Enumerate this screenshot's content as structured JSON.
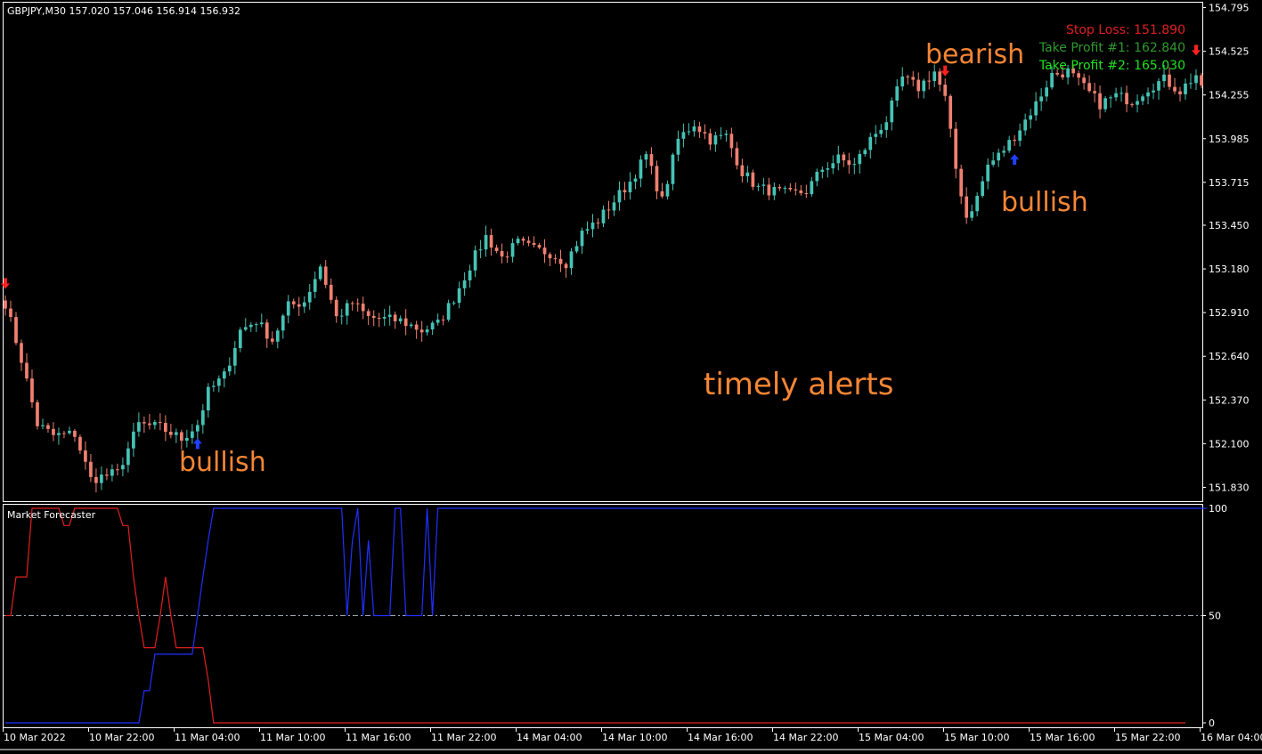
{
  "window": {
    "symbol_line": "GBPJPY,M30  157.020 157.046 156.914 156.932",
    "indicator_name": "Market Forecaster"
  },
  "colors": {
    "background": "#000000",
    "frame": "#ffffff",
    "bull_candle": "#45c3b5",
    "bear_candle": "#f08070",
    "annotation": "#f58634",
    "stop_loss": "#e02020",
    "take_profit_1": "#2e9a2e",
    "take_profit_2": "#22e022",
    "buy_arrow": "#2040ff",
    "sell_arrow": "#ff2020",
    "line_red": "#e02020",
    "line_blue": "#2030ff",
    "midline": "#9aa4b4"
  },
  "levels": {
    "stop_loss": "Stop Loss: 151.890",
    "take_profit_1": "Take Profit #1: 162.840",
    "take_profit_2": "Take Profit #2: 165.030"
  },
  "annotations": {
    "bullish_left": "bullish",
    "bullish_right": "bullish",
    "bearish": "bearish",
    "timely_alerts": "timely alerts"
  },
  "chart_data": [
    {
      "type": "candlestick",
      "title": "GBPJPY,M30",
      "ylim": [
        151.75,
        154.82
      ],
      "y_ticks": [
        "154.795",
        "154.525",
        "154.255",
        "153.985",
        "153.715",
        "153.450",
        "153.180",
        "152.910",
        "152.640",
        "152.370",
        "152.100",
        "151.830"
      ],
      "x_ticks": [
        "10 Mar 2022",
        "10 Mar 22:00",
        "11 Mar 04:00",
        "11 Mar 10:00",
        "11 Mar 16:00",
        "11 Mar 22:00",
        "14 Mar 04:00",
        "14 Mar 10:00",
        "14 Mar 16:00",
        "14 Mar 22:00",
        "15 Mar 04:00",
        "15 Mar 10:00",
        "15 Mar 16:00",
        "15 Mar 22:00",
        "16 Mar 04:00"
      ],
      "signals": [
        {
          "type": "sell",
          "index": 0
        },
        {
          "type": "buy",
          "index": 36
        },
        {
          "type": "sell",
          "index": 176
        },
        {
          "type": "buy",
          "index": 189
        },
        {
          "type": "sell",
          "index": 223
        }
      ],
      "close_path": [
        [
          0,
          152.97
        ],
        [
          3,
          152.62
        ],
        [
          6,
          152.22
        ],
        [
          9,
          152.15
        ],
        [
          13,
          152.16
        ],
        [
          16,
          151.88
        ],
        [
          21,
          151.92
        ],
        [
          25,
          152.22
        ],
        [
          29,
          152.2
        ],
        [
          33,
          152.13
        ],
        [
          36,
          152.22
        ],
        [
          38,
          152.42
        ],
        [
          41,
          152.52
        ],
        [
          44,
          152.8
        ],
        [
          47,
          152.86
        ],
        [
          50,
          152.74
        ],
        [
          53,
          152.95
        ],
        [
          56,
          152.98
        ],
        [
          59,
          153.2
        ],
        [
          62,
          152.88
        ],
        [
          65,
          152.97
        ],
        [
          68,
          152.88
        ],
        [
          71,
          152.87
        ],
        [
          74,
          152.86
        ],
        [
          78,
          152.8
        ],
        [
          81,
          152.84
        ],
        [
          84,
          153.0
        ],
        [
          87,
          153.2
        ],
        [
          90,
          153.38
        ],
        [
          93,
          153.25
        ],
        [
          96,
          153.34
        ],
        [
          99,
          153.3
        ],
        [
          102,
          153.28
        ],
        [
          105,
          153.22
        ],
        [
          108,
          153.4
        ],
        [
          111,
          153.48
        ],
        [
          114,
          153.6
        ],
        [
          117,
          153.72
        ],
        [
          120,
          153.88
        ],
        [
          123,
          153.6
        ],
        [
          126,
          153.98
        ],
        [
          129,
          154.08
        ],
        [
          132,
          153.98
        ],
        [
          135,
          154.0
        ],
        [
          138,
          153.78
        ],
        [
          141,
          153.68
        ],
        [
          144,
          153.66
        ],
        [
          147,
          153.64
        ],
        [
          150,
          153.66
        ],
        [
          153,
          153.8
        ],
        [
          156,
          153.86
        ],
        [
          159,
          153.82
        ],
        [
          162,
          153.98
        ],
        [
          165,
          154.1
        ],
        [
          168,
          154.36
        ],
        [
          171,
          154.3
        ],
        [
          174,
          154.4
        ],
        [
          176,
          154.23
        ],
        [
          178,
          153.8
        ],
        [
          180,
          153.5
        ],
        [
          182,
          153.62
        ],
        [
          184,
          153.82
        ],
        [
          186,
          153.88
        ],
        [
          188,
          153.96
        ],
        [
          190,
          154.05
        ],
        [
          193,
          154.2
        ],
        [
          196,
          154.38
        ],
        [
          199,
          154.4
        ],
        [
          202,
          154.3
        ],
        [
          205,
          154.2
        ],
        [
          208,
          154.25
        ],
        [
          211,
          154.22
        ],
        [
          214,
          154.3
        ],
        [
          217,
          154.35
        ],
        [
          220,
          154.28
        ],
        [
          223,
          154.38
        ],
        [
          224,
          154.28
        ]
      ]
    },
    {
      "type": "line",
      "title": "Market Forecaster",
      "ylim": [
        0,
        100
      ],
      "y_ticks": [
        "100",
        "50",
        "0"
      ],
      "series": [
        {
          "color": "#e02020",
          "values": [
            50,
            50,
            68,
            68,
            68,
            100,
            100,
            100,
            100,
            100,
            100,
            92,
            92,
            100,
            100,
            100,
            100,
            100,
            100,
            100,
            100,
            100,
            92,
            92,
            68,
            50,
            35,
            35,
            35,
            50,
            68,
            50,
            35,
            35,
            35,
            35,
            35,
            35,
            20,
            0,
            0,
            0,
            0,
            0,
            0,
            0,
            0,
            0,
            0,
            0,
            0,
            0,
            0,
            0,
            0,
            0,
            0,
            0,
            0,
            0,
            0,
            0,
            0,
            0,
            0,
            0,
            0,
            0,
            0,
            0,
            0,
            0,
            0,
            0,
            0,
            0,
            0,
            0,
            0,
            0,
            0,
            0,
            0,
            0,
            0,
            0,
            0,
            0,
            0,
            0,
            0,
            0,
            0,
            0,
            0,
            0,
            0,
            0,
            0,
            0,
            0,
            0,
            0,
            0,
            0,
            0,
            0,
            0,
            0,
            0,
            0,
            0,
            0,
            0,
            0,
            0,
            0,
            0,
            0,
            0,
            0,
            0,
            0,
            0,
            0,
            0,
            0,
            0,
            0,
            0,
            0,
            0,
            0,
            0,
            0,
            0,
            0,
            0,
            0,
            0,
            0,
            0,
            0,
            0,
            0,
            0,
            0,
            0,
            0,
            0,
            0,
            0,
            0,
            0,
            0,
            0,
            0,
            0,
            0,
            0,
            0,
            0,
            0,
            0,
            0,
            0,
            0,
            0,
            0,
            0,
            0,
            0,
            0,
            0,
            0,
            0,
            0,
            0,
            0,
            0,
            0,
            0,
            0,
            0,
            0,
            0,
            0,
            0,
            0,
            0,
            0,
            0,
            0,
            0,
            0,
            0,
            0,
            0,
            0,
            0,
            0,
            0,
            0,
            0,
            0,
            0,
            0,
            0,
            0,
            0,
            0,
            0,
            0,
            0,
            0,
            0,
            0,
            0,
            0,
            0,
            0,
            0
          ]
        },
        {
          "color": "#2030ff",
          "values": [
            0,
            0,
            0,
            0,
            0,
            0,
            0,
            0,
            0,
            0,
            0,
            0,
            0,
            0,
            0,
            0,
            0,
            0,
            0,
            0,
            0,
            0,
            0,
            0,
            0,
            0,
            15,
            15,
            32,
            32,
            32,
            32,
            32,
            32,
            32,
            32,
            50,
            68,
            85,
            100,
            100,
            100,
            100,
            100,
            100,
            100,
            100,
            100,
            100,
            100,
            100,
            100,
            100,
            100,
            100,
            100,
            100,
            100,
            100,
            100,
            100,
            100,
            100,
            100,
            50,
            85,
            100,
            50,
            85,
            50,
            50,
            50,
            50,
            100,
            100,
            50,
            50,
            50,
            50,
            100,
            50,
            100,
            100,
            100,
            100,
            100,
            100,
            100,
            100,
            100,
            100,
            100,
            100,
            100,
            100,
            100,
            100,
            100,
            100,
            100,
            100,
            100,
            100,
            100,
            100,
            100,
            100,
            100,
            100,
            100,
            100,
            100,
            100,
            100,
            100,
            100,
            100,
            100,
            100,
            100,
            100,
            100,
            100,
            100,
            100,
            100,
            100,
            100,
            100,
            100,
            100,
            100,
            100,
            100,
            100,
            100,
            100,
            100,
            100,
            100,
            100,
            100,
            100,
            100,
            100,
            100,
            100,
            100,
            100,
            100,
            100,
            100,
            100,
            100,
            100,
            100,
            100,
            100,
            100,
            100,
            100,
            100,
            100,
            100,
            100,
            100,
            100,
            100,
            100,
            100,
            100,
            100,
            100,
            100,
            100,
            100,
            100,
            100,
            100,
            100,
            100,
            100,
            100,
            100,
            100,
            100,
            100,
            100,
            100,
            100,
            100,
            100,
            100,
            100,
            100,
            100,
            100,
            100,
            100,
            100,
            100,
            100,
            100,
            100,
            100,
            100,
            100,
            100,
            100,
            100,
            100,
            100,
            100,
            100,
            100,
            100,
            100,
            100,
            100,
            100,
            100,
            100,
            100,
            100,
            100,
            100
          ]
        }
      ],
      "midline": 50
    }
  ]
}
